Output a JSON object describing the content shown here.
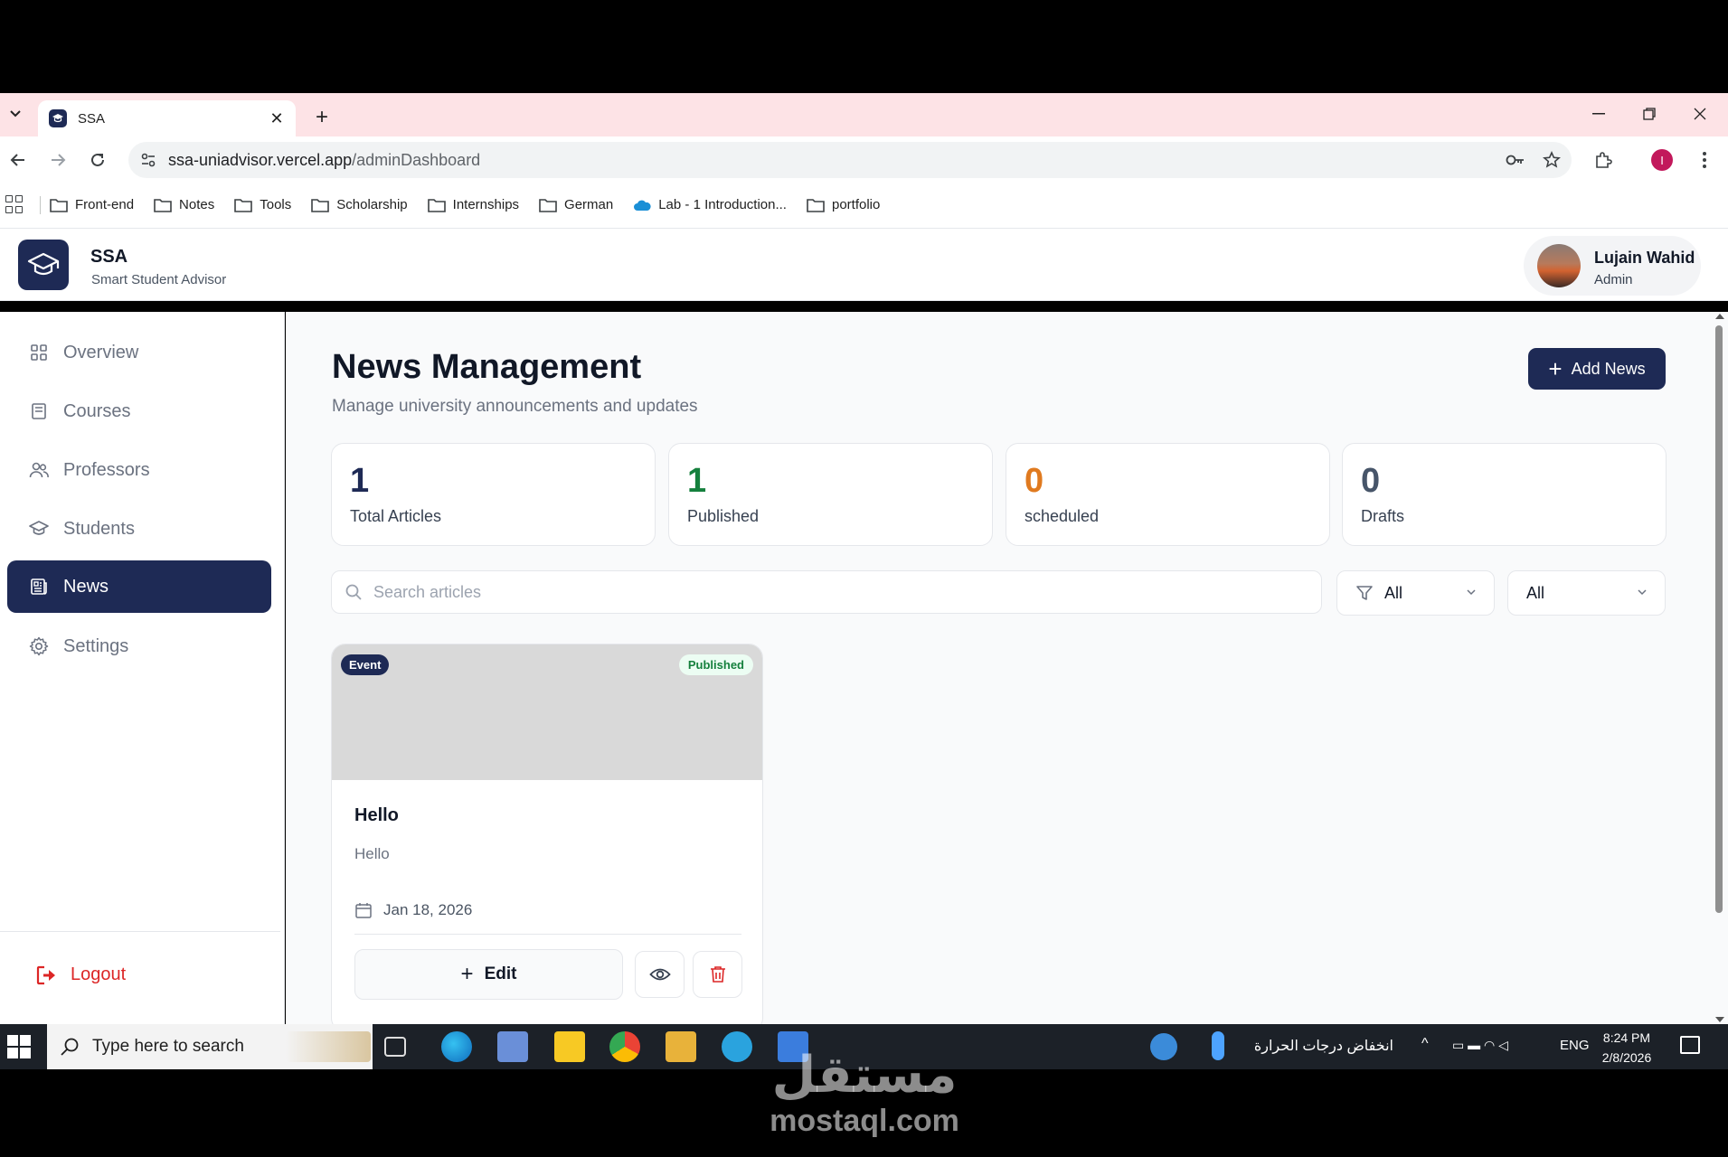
{
  "browser": {
    "tab_title": "SSA",
    "url_host": "ssa-uniadvisor.vercel.app",
    "url_path": "/adminDashboard",
    "profile_initial": "I",
    "bookmarks": [
      "Front-end",
      "Notes",
      "Tools",
      "Scholarship",
      "Internships",
      "German",
      "Lab - 1 Introduction...",
      "portfolio"
    ]
  },
  "app": {
    "brand_name": "SSA",
    "brand_sub": "Smart Student Advisor",
    "user_name": "Lujain Wahid",
    "user_role": "Admin"
  },
  "sidebar": {
    "items": [
      {
        "label": "Overview",
        "icon": "grid-icon"
      },
      {
        "label": "Courses",
        "icon": "book-icon"
      },
      {
        "label": "Professors",
        "icon": "users-icon"
      },
      {
        "label": "Students",
        "icon": "graduation-cap-icon"
      },
      {
        "label": "News",
        "icon": "newspaper-icon",
        "active": true
      },
      {
        "label": "Settings",
        "icon": "gear-icon"
      }
    ],
    "logout_label": "Logout"
  },
  "main": {
    "title": "News Management",
    "subtitle": "Manage university announcements and updates",
    "add_button_label": "Add News",
    "stats": [
      {
        "value": "1",
        "label": "Total Articles",
        "color": "#1e2a55"
      },
      {
        "value": "1",
        "label": "Published",
        "color": "#15803d"
      },
      {
        "value": "0",
        "label": "scheduled",
        "color": "#e07a1f"
      },
      {
        "value": "0",
        "label": "Drafts",
        "color": "#475569"
      }
    ],
    "search_placeholder": "Search articles",
    "filter_category": "All",
    "filter_status": "All",
    "articles": [
      {
        "category": "Event",
        "status": "Published",
        "title": "Hello",
        "description": "Hello",
        "date": "Jan 18, 2026",
        "edit_label": "Edit"
      }
    ]
  },
  "taskbar": {
    "search_placeholder": "Type here to search",
    "weather_text": "انخفاض درجات الحرارة",
    "language": "ENG",
    "time": "8:24 PM",
    "date": "2/8/2026"
  },
  "watermark": {
    "arabic": "مستقل",
    "latin": "mostaql.com"
  },
  "colors": {
    "primary": "#1e2a55",
    "danger": "#dc2626",
    "chrome_tabstrip": "#fde3e6"
  }
}
